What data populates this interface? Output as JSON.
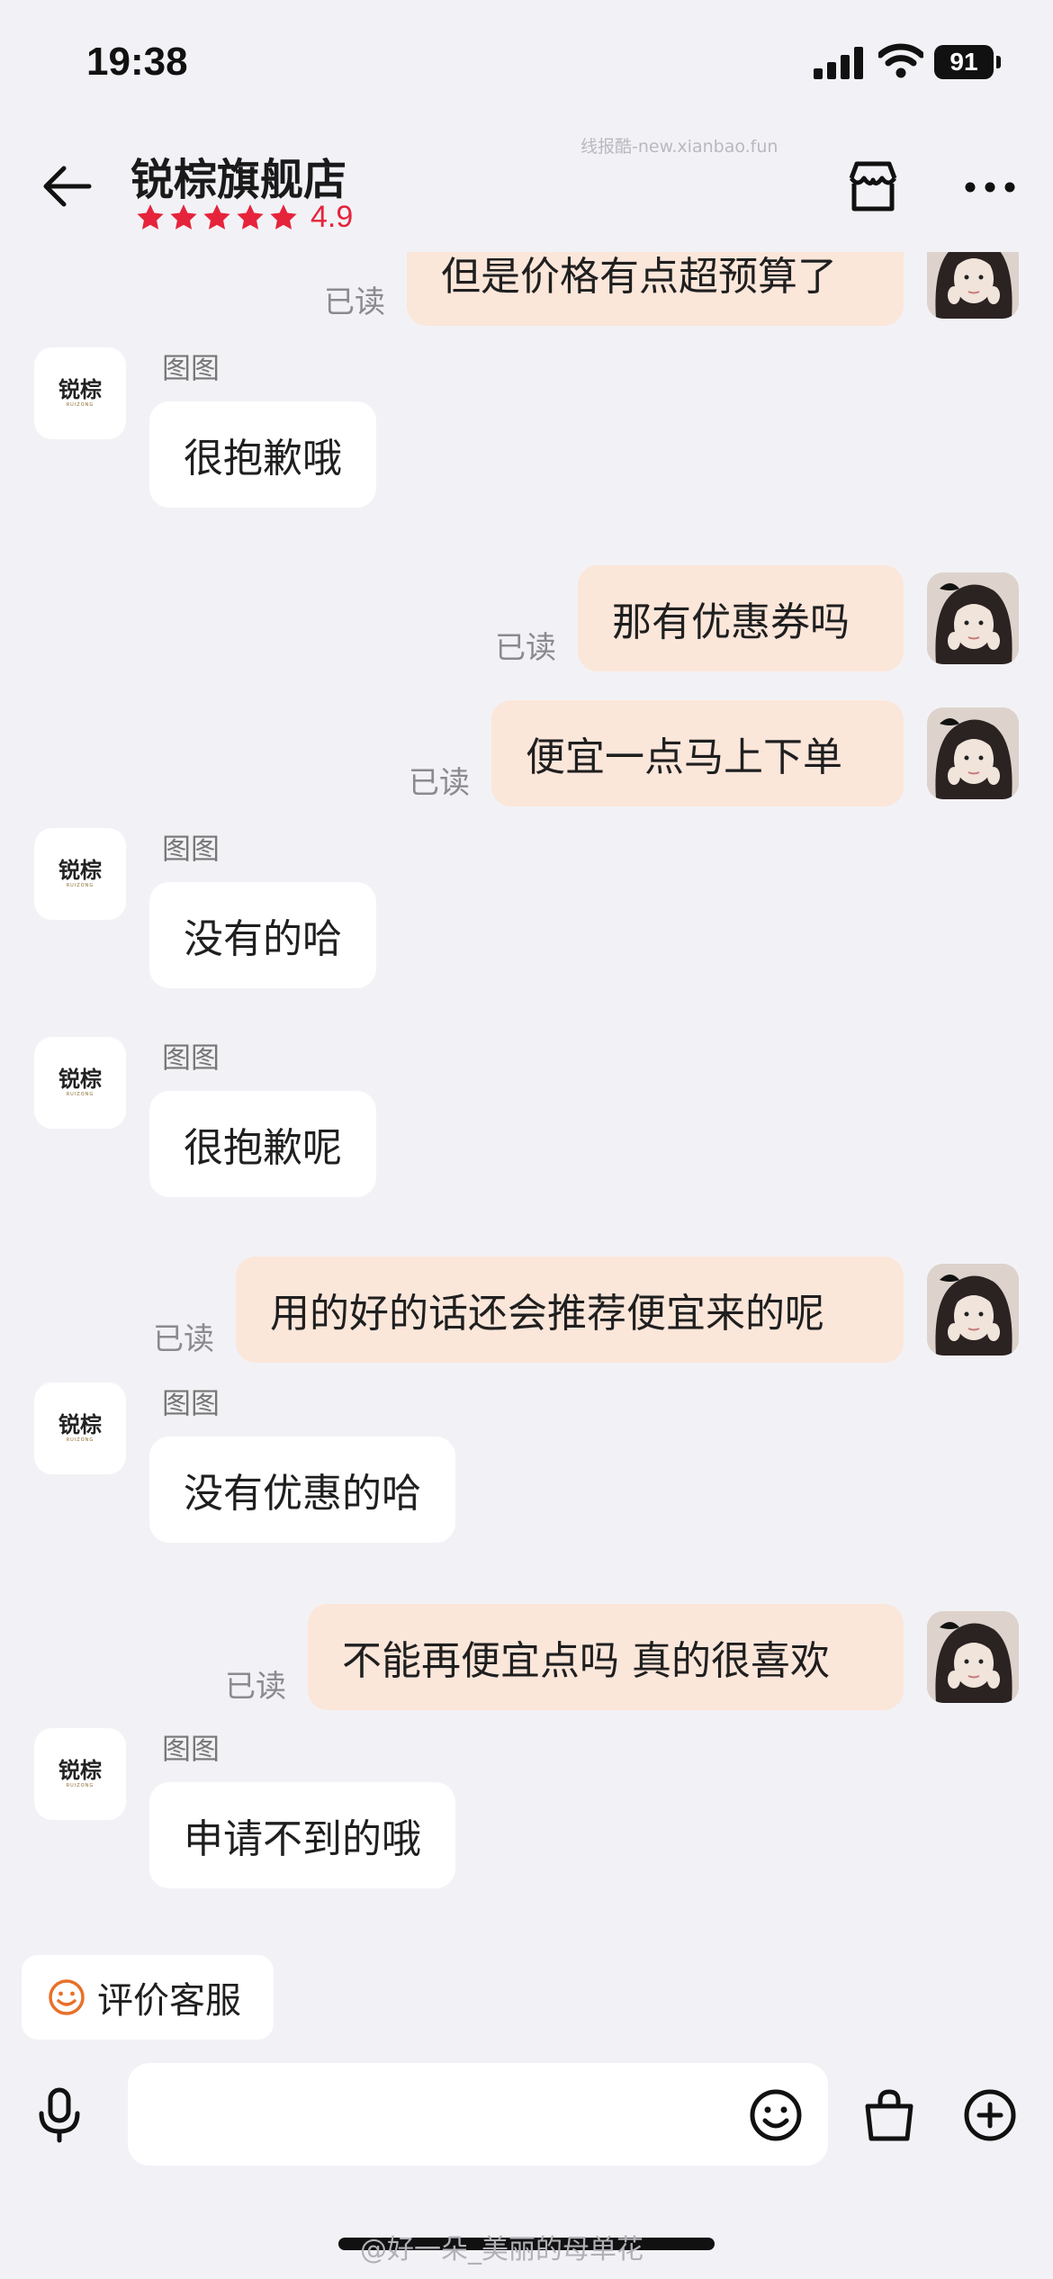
{
  "status_bar": {
    "time": "19:38",
    "battery": "91"
  },
  "header": {
    "store_name": "锐棕旗舰店",
    "rating": "4.9",
    "watermark": "线报酷-new.xianbao.fun"
  },
  "store_avatar": {
    "logo_text": "锐棕",
    "logo_sub": "RUIZONG"
  },
  "messages": [
    {
      "side": "right",
      "text": "但是价格有点超预算了",
      "read": "已读"
    },
    {
      "side": "left",
      "sender": "图图",
      "text": "很抱歉哦"
    },
    {
      "side": "right",
      "text": "那有优惠券吗",
      "read": "已读"
    },
    {
      "side": "right",
      "text": "便宜一点马上下单",
      "read": "已读"
    },
    {
      "side": "left",
      "sender": "图图",
      "text": "没有的哈"
    },
    {
      "side": "left",
      "sender": "图图",
      "text": "很抱歉呢"
    },
    {
      "side": "right",
      "text": "用的好的话还会推荐便宜来的呢",
      "read": "已读"
    },
    {
      "side": "left",
      "sender": "图图",
      "text": "没有优惠的哈"
    },
    {
      "side": "right",
      "text": "不能再便宜点吗 真的很喜欢",
      "read": "已读"
    },
    {
      "side": "left",
      "sender": "图图",
      "text": "申请不到的哦"
    }
  ],
  "rate_service": {
    "label": "评价客服"
  },
  "input": {
    "placeholder": ""
  },
  "footer": {
    "watermark": "@好一朵_美丽的母单花"
  },
  "colors": {
    "background": "#f2f2f6",
    "my_bubble": "#fbe6da",
    "their_bubble": "#ffffff",
    "rating_red": "#e5243c",
    "emoji_orange": "#e8702a"
  }
}
